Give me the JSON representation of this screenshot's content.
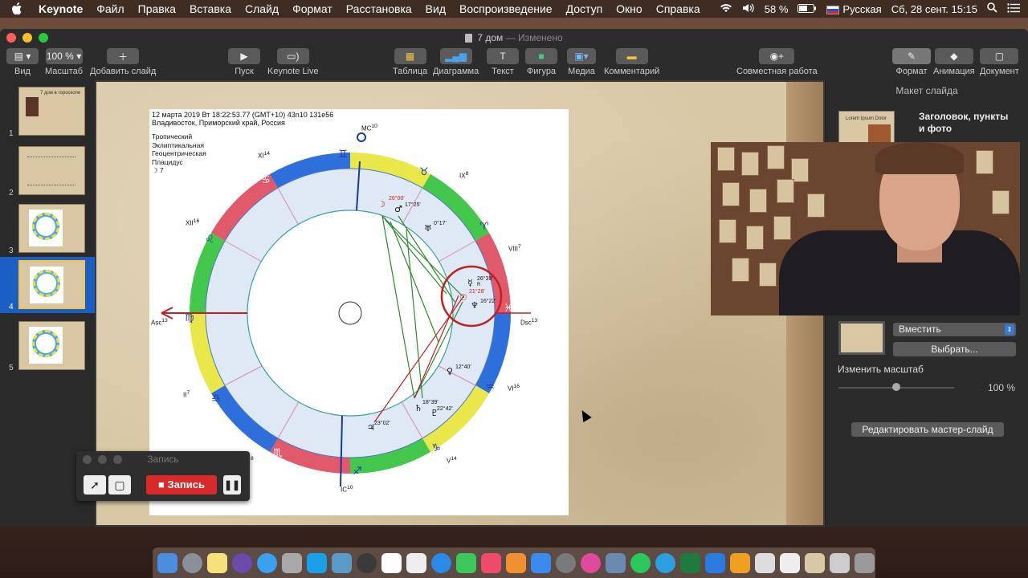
{
  "menubar": {
    "app_name": "Keynote",
    "items": [
      "Файл",
      "Правка",
      "Вставка",
      "Слайд",
      "Формат",
      "Расстановка",
      "Вид",
      "Воспроизведение",
      "Доступ",
      "Окно",
      "Справка"
    ],
    "battery": "58 %",
    "input_language": "Русская",
    "datetime": "Сб, 28 сент.  15:15"
  },
  "window": {
    "title": "7 дом",
    "status": "— Изменено"
  },
  "toolbar": {
    "view": "Вид",
    "zoom_value": "100 %",
    "zoom": "Масштаб",
    "add_slide": "Добавить слайд",
    "play": "Пуск",
    "keynote_live": "Keynote Live",
    "table": "Таблица",
    "chart": "Диаграмма",
    "text": "Текст",
    "shape": "Фигура",
    "media": "Медиа",
    "comment": "Комментарий",
    "collaborate": "Совместная работа",
    "format": "Формат",
    "animate": "Анимация",
    "document": "Документ"
  },
  "navigator": {
    "slides": [
      {
        "num": "1",
        "title": "7 дом в гороскопе"
      },
      {
        "num": "2"
      },
      {
        "num": "3"
      },
      {
        "num": "4",
        "active": true
      },
      {
        "num": "5"
      }
    ]
  },
  "chart": {
    "header_line1": "12 марта 2019  Вт  18:22:53.77 (GMT+10) 43n10  131e56",
    "header_line2": "Владивосток, Приморский край, Россия",
    "meta": [
      "Тропический",
      "Эклиптикальная",
      "Геоцентрическая",
      "Плацидус",
      "☽  7"
    ],
    "asc_label": "Asc",
    "asc_num": "13",
    "dsc_label": "Dsc",
    "dsc_num": "13",
    "mc_label": "MC",
    "mc_num": "10",
    "ic_label": "IC",
    "ic_num": "10",
    "houses": [
      {
        "label": "IX",
        "num": "8"
      },
      {
        "label": "VIII",
        "num": "7"
      },
      {
        "label": "VI",
        "num": "16"
      },
      {
        "label": "V",
        "num": "14"
      },
      {
        "label": "II",
        "num": "7"
      },
      {
        "label": "XII",
        "num": "16"
      },
      {
        "label": "XI",
        "num": "14"
      }
    ],
    "house_iii_num": "8",
    "planets": [
      {
        "label": "26°00'",
        "color": "#c02020"
      },
      {
        "label": "17°25'"
      },
      {
        "label": "0°17'"
      },
      {
        "label": "26°39'"
      },
      {
        "label": "R"
      },
      {
        "label": "21°28'",
        "color": "#c02020"
      },
      {
        "label": "16°22'"
      },
      {
        "label": "12°40'"
      },
      {
        "label": "18°39'"
      },
      {
        "label": "22°42'"
      },
      {
        "label": "23°02'"
      }
    ]
  },
  "inspector": {
    "section_title": "Макет слайда",
    "layout_name": "Заголовок, пункты и фото",
    "layout_preview_text": "Lorem Ipsum Dolor",
    "fit_option": "Вместить",
    "choose": "Выбрать...",
    "scale_label": "Изменить масштаб",
    "scale_value": "100 %",
    "scale_fraction": 0.5,
    "edit_master": "Редактировать мастер-слайд"
  },
  "recorder": {
    "title": "Запись",
    "record": "Запись"
  }
}
